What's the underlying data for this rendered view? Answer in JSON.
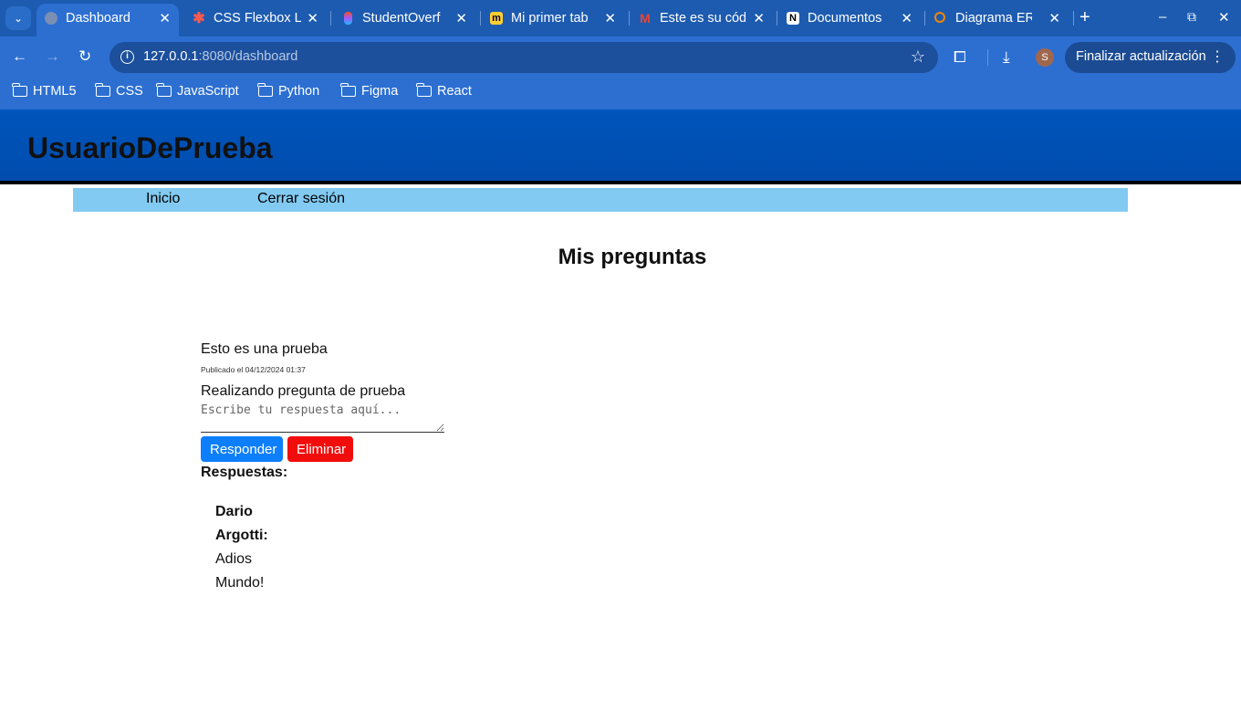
{
  "browser": {
    "tabs": [
      {
        "title": "Dashboard",
        "favicon": "globe-icon"
      },
      {
        "title": "CSS Flexbox L",
        "favicon": "asterisk-icon"
      },
      {
        "title": "StudentOverf",
        "favicon": "figma-icon"
      },
      {
        "title": "Mi primer tab",
        "favicon": "miro-icon"
      },
      {
        "title": "Este es su cód",
        "favicon": "gmail-icon"
      },
      {
        "title": "Documentos",
        "favicon": "notion-icon"
      },
      {
        "title": "Diagrama ER",
        "favicon": "draw-icon"
      }
    ],
    "url_host": "127.0.0.1",
    "url_rest": ":8080/dashboard",
    "profile_initial": "S",
    "update_label": "Finalizar actualización",
    "bookmarks": [
      "HTML5",
      "CSS",
      "JavaScript",
      "Python",
      "Figma",
      "React"
    ]
  },
  "site": {
    "user_name": "UsuarioDePrueba",
    "nav": {
      "home": "Inicio",
      "logout": "Cerrar sesión"
    },
    "page_title": "Mis preguntas"
  },
  "question": {
    "title": "Esto es una prueba",
    "date": "Publicado el 04/12/2024 01:37",
    "body": "Realizando pregunta de prueba",
    "answer_placeholder": "Escribe tu respuesta aquí...",
    "reply_label": "Responder",
    "delete_label": "Eliminar",
    "responses_label": "Respuestas:",
    "responses": [
      {
        "author": "Dario Argotti:",
        "text": "Adios Mundo!"
      }
    ]
  },
  "colors": {
    "header_bg": "#0055bb",
    "nav_bg": "#82caf2",
    "reply_button": "#0d7efc",
    "delete_button": "#f20d0d"
  }
}
